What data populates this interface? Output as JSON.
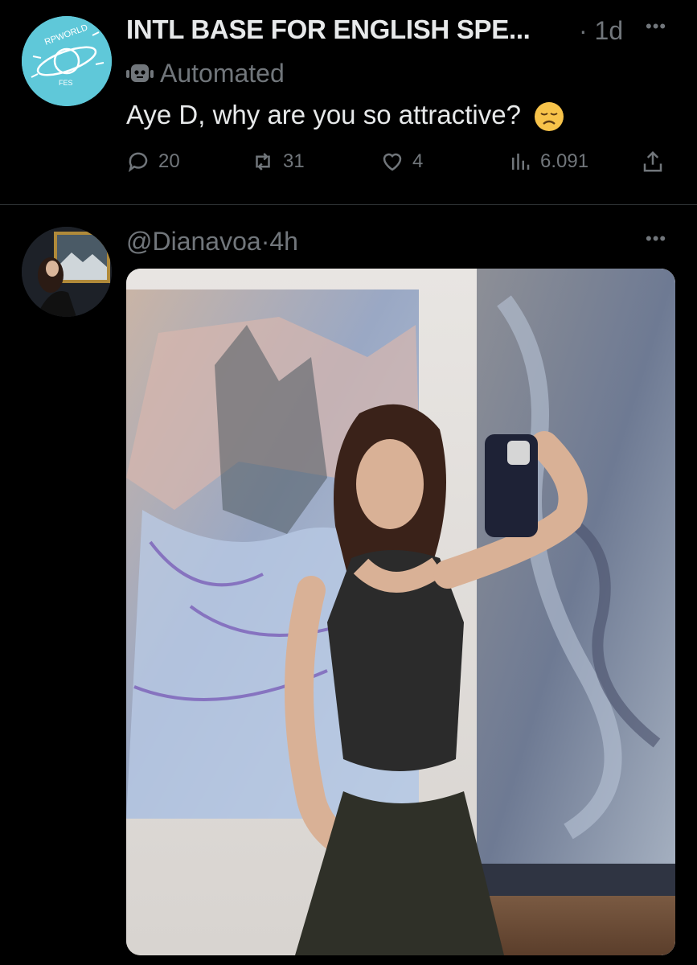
{
  "tweets": [
    {
      "display_name": "INTL BASE FOR ENGLISH SPE...",
      "separator": "·",
      "time": "1d",
      "badge_label": "Automated",
      "text": "Aye D, why are you so attractive?",
      "emoji_icon": "disappointed-face-emoji",
      "more_label": "•••",
      "actions": {
        "replies": "20",
        "retweets": "31",
        "likes": "4",
        "views": "6.091"
      },
      "avatar_icon": "planet-logo",
      "avatar_color": "#5fc8d9"
    },
    {
      "handle": "@Dianavoa",
      "separator": "·",
      "time": "4h",
      "more_label": "•••",
      "media_description_icon": "photo"
    }
  ],
  "colors": {
    "background": "#000000",
    "primary_text": "#e7e9ea",
    "secondary_text": "#71767b",
    "divider": "#2f3336"
  }
}
